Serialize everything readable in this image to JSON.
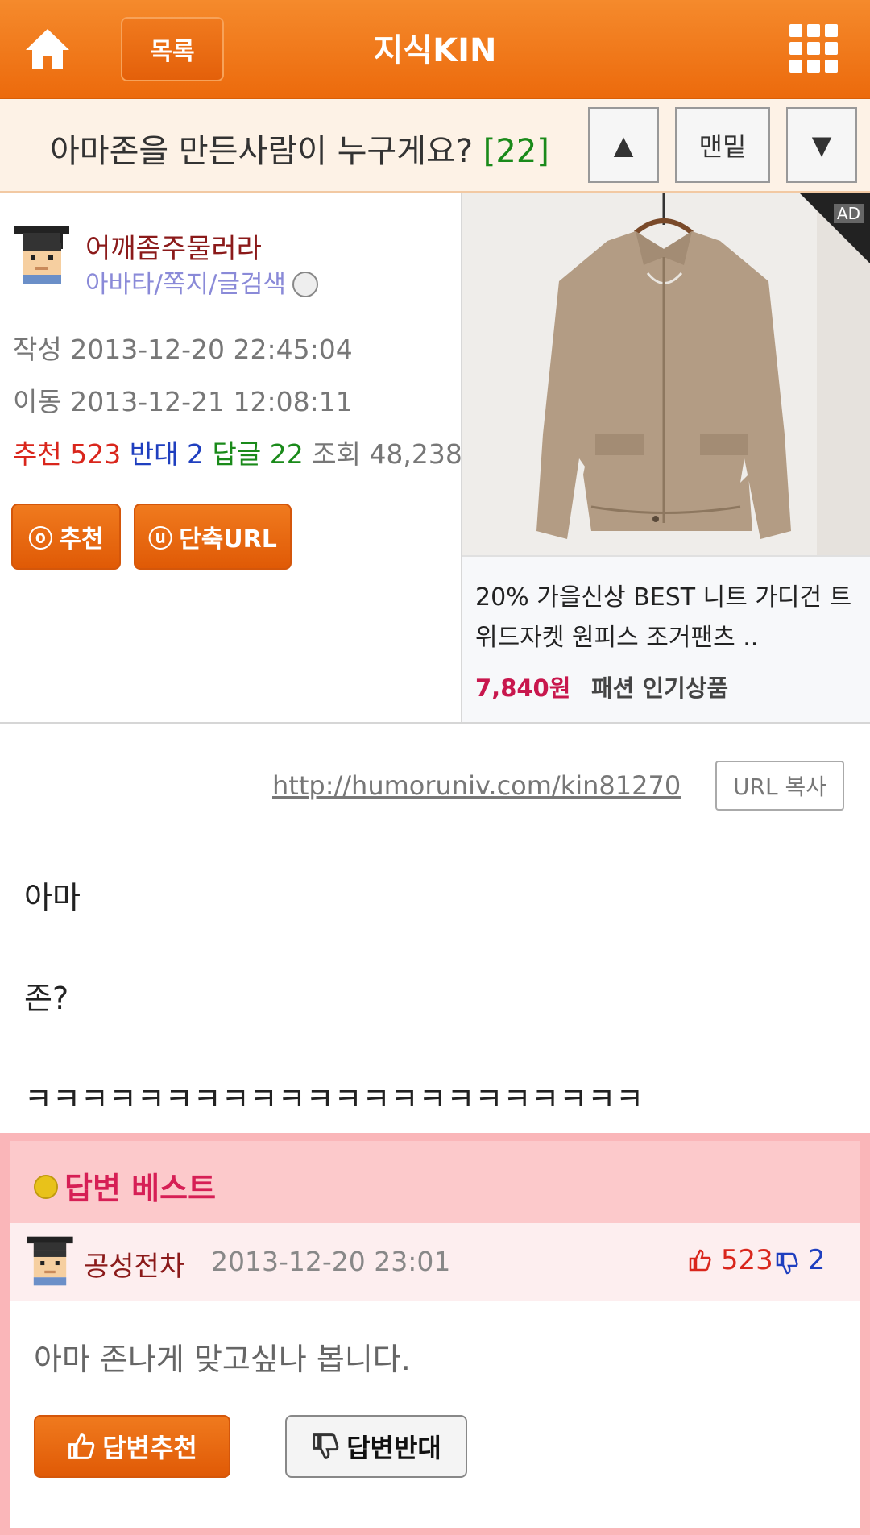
{
  "header": {
    "list_label": "목록",
    "title": "지식KIN",
    "home_icon": "home-icon",
    "menu_icon": "grid-menu-icon"
  },
  "question": {
    "title": "아마존을 만든사람이 누구게요?",
    "reply_count": "[22]",
    "up_label": "▲",
    "bottom_label": "맨밑",
    "down_label": "▼"
  },
  "author": {
    "nickname": "어깨좀주물러라",
    "links": "아바타/쪽지/글검색",
    "written_label": "작성",
    "written_at": "2013-12-20 22:45:04",
    "moved_label": "이동",
    "moved_at": "2013-12-21 12:08:11",
    "recommend_label": "추천",
    "recommend_count": "523",
    "oppose_label": "반대",
    "oppose_count": "2",
    "reply_label": "답글",
    "reply_count": "22",
    "views_label": "조회",
    "views_count": "48,238",
    "recommend_button": "추천",
    "recommend_button_icon": "ⓞ",
    "shorturl_button": "단축URL",
    "shorturl_button_icon": "ⓤ"
  },
  "ad": {
    "badge": "AD",
    "text": "20% 가을신상 BEST 니트 가디건 트위드자켓 원피스 조거팬츠 ..",
    "price": "7,840원",
    "category": "패션 인기상품"
  },
  "post": {
    "url": "http://humoruniv.com/kin81270",
    "copy_label": "URL 복사",
    "lines": [
      "아마",
      "존?",
      "ㅋㅋㅋㅋㅋㅋㅋㅋㅋㅋㅋㅋㅋㅋㅋㅋㅋㅋㅋㅋㅋㅋ"
    ]
  },
  "best_answer": {
    "section_title": "답변 베스트",
    "nickname": "공성전차",
    "date": "2013-12-20 23:01",
    "up_count": "523",
    "down_count": "2",
    "body": "아마 존나게 맞고싶나 봅니다.",
    "recommend_label": "답변추천",
    "oppose_label": "답변반대"
  },
  "colors": {
    "accent_orange": "#ec6a0c",
    "best_pink": "#fab6b9",
    "best_title": "#d61f55",
    "recommend_red": "#d9261c",
    "oppose_blue": "#1f3fbf",
    "reply_green": "#1a8a1a"
  }
}
